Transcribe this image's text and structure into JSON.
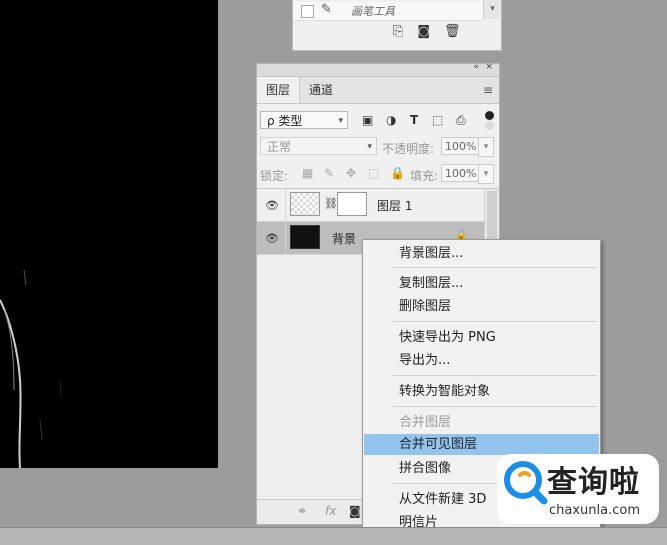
{
  "brushes_panel": {
    "brush_name": "画笔工具"
  },
  "layers_panel": {
    "tabs": [
      {
        "label": "图层",
        "active": true
      },
      {
        "label": "通道",
        "active": false
      }
    ],
    "filter": {
      "kind_label": "ρ 类型"
    },
    "blend": {
      "mode": "正常",
      "opacity_label": "不透明度:",
      "opacity_value": "100%"
    },
    "lock": {
      "label": "锁定:",
      "fill_label": "填充:",
      "fill_value": "100%"
    },
    "layers": [
      {
        "name": "图层 1",
        "visible": true,
        "has_mask": true,
        "selected": false
      },
      {
        "name": "背景",
        "visible": true,
        "locked": true,
        "selected": true
      }
    ],
    "footer": {
      "fx_label": "fx"
    }
  },
  "context_menu": {
    "items": [
      {
        "label": "背景图层...",
        "enabled": true
      },
      {
        "label": "复制图层...",
        "enabled": true
      },
      {
        "label": "删除图层",
        "enabled": true
      },
      {
        "label": "快速导出为 PNG",
        "enabled": true
      },
      {
        "label": "导出为...",
        "enabled": true
      },
      {
        "label": "转换为智能对象",
        "enabled": true
      },
      {
        "label": "合并图层",
        "enabled": false
      },
      {
        "label": "合并可见图层",
        "enabled": true,
        "highlighted": true
      },
      {
        "label": "拼合图像",
        "enabled": true
      },
      {
        "label": "从文件新建 3D",
        "enabled": true
      },
      {
        "label": "明信片",
        "enabled": true
      }
    ]
  },
  "watermark": {
    "title": "查询啦",
    "url": "chaxunla.com"
  },
  "colors": {
    "menu_highlight": "#92c4ee",
    "watermark_blue": "#1a8fe8"
  }
}
